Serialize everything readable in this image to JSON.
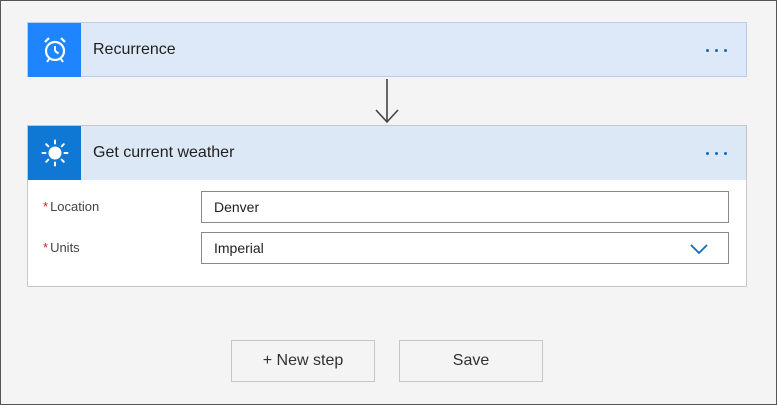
{
  "recurrence": {
    "title": "Recurrence",
    "icon": "alarm-clock-icon",
    "more_icon": "ellipsis-icon"
  },
  "weather": {
    "title": "Get current weather",
    "icon": "sun-icon",
    "more_icon": "ellipsis-icon",
    "fields": [
      {
        "required_mark": "*",
        "label": "Location",
        "value": "Denver"
      },
      {
        "required_mark": "*",
        "label": "Units",
        "value": "Imperial"
      }
    ]
  },
  "actions": {
    "new_step_label": "+ New step",
    "save_label": "Save"
  },
  "colors": {
    "accent": "#0f78d4",
    "recurrence_icon_bg": "#1f85ff",
    "required": "#c62828"
  }
}
